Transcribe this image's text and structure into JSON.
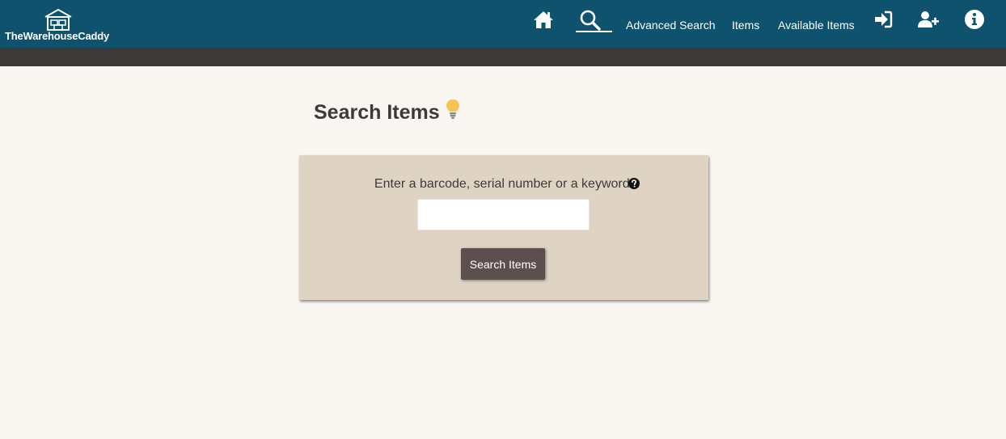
{
  "brand": {
    "name": "TheWarehouseCaddy",
    "logo_icon": "warehouse-icon"
  },
  "nav": {
    "icons": {
      "home": "home-icon",
      "search": "search-icon",
      "login": "sign-in-icon",
      "register": "add-user-icon",
      "info": "info-icon"
    },
    "links": {
      "advanced_search": "Advanced Search",
      "items": "Items",
      "available_items": "Available Items"
    },
    "active": "search"
  },
  "main": {
    "title": "Search Items",
    "title_icon": "lightbulb-icon",
    "search": {
      "prompt": "Enter a barcode, serial number or a keyword.",
      "help_icon": "question-circle-icon",
      "value": "",
      "placeholder": "",
      "button_label": "Search Items"
    }
  },
  "colors": {
    "navbar": "#0e526e",
    "subbar": "#3f3a3a",
    "background": "#faf7f2",
    "panel": "#dfd3c3",
    "button": "#5e4f4f",
    "bulb": "#f5c451"
  }
}
